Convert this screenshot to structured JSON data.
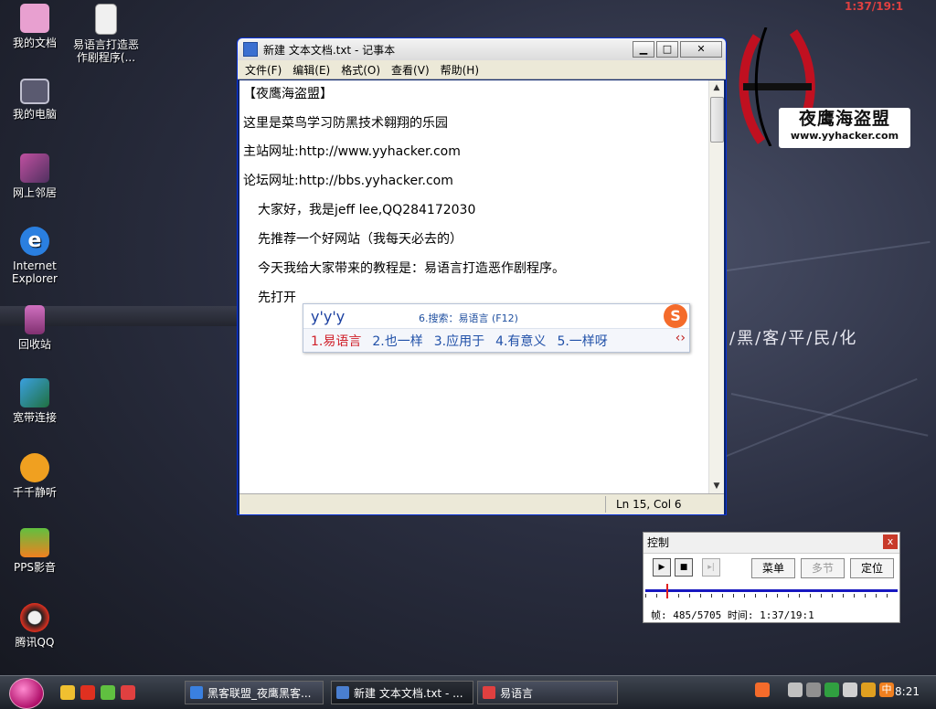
{
  "wallpaper": {
    "brand_cn": "夜鹰海盗盟",
    "brand_url": "www.yyhacker.com",
    "slogan": "/黑/客/平/民/化",
    "clock_overlay": "1:37/19:1"
  },
  "desktop_icons": [
    {
      "label": "我的文档",
      "icon": "my-documents-icon",
      "color": "#e8a0d0"
    },
    {
      "label": "易语言打造恶作剧程序(...",
      "icon": "text-document-icon",
      "color": "#f0f0f0"
    },
    {
      "label": "我的电脑",
      "icon": "my-computer-icon",
      "color": "#5a5a70"
    },
    {
      "label": "网上邻居",
      "icon": "network-places-icon",
      "color": "#c050a0"
    },
    {
      "label": "Internet Explorer",
      "icon": "internet-explorer-icon",
      "color": "#2a7fe0"
    },
    {
      "label": "回收站",
      "icon": "recycle-bin-icon",
      "color": "#c060b0"
    },
    {
      "label": "宽带连接",
      "icon": "broadband-connection-icon",
      "color": "#3aa0e0"
    },
    {
      "label": "千千静听",
      "icon": "ttplayer-icon",
      "color": "#f0a020"
    },
    {
      "label": "PPS影音",
      "icon": "pps-player-icon",
      "color": "#f08020"
    },
    {
      "label": "腾讯QQ",
      "icon": "tencent-qq-icon",
      "color": "#e03020"
    }
  ],
  "notepad": {
    "title": "新建 文本文档.txt - 记事本",
    "menu": [
      "文件(F)",
      "编辑(E)",
      "格式(O)",
      "查看(V)",
      "帮助(H)"
    ],
    "lines": [
      "【夜鹰海盗盟】",
      "这里是菜鸟学习防黑技术翱翔的乐园",
      "主站网址:http://www.yyhacker.com",
      "论坛网址:http://bbs.yyhacker.com",
      "大家好，我是jeff lee,QQ284172030",
      "先推荐一个好网站（我每天必去的）",
      "今天我给大家带来的教程是：易语言打造恶作剧程序。",
      "先打开"
    ],
    "status_position": "Ln 15, Col 6"
  },
  "ime": {
    "composition": "y'y'y",
    "search_hint": "6.搜索：易语言 (F12)",
    "logo": "S",
    "candidates": [
      "1.易语言",
      "2.也一样",
      "3.应用于",
      "4.有意义",
      "5.一样呀"
    ]
  },
  "control_panel": {
    "title": "控制",
    "close": "x",
    "buttons": [
      "菜单",
      "多节",
      "定位"
    ],
    "frame_label": "帧:",
    "frame_value": "485/5705",
    "time_label": "时间:",
    "time_value": "1:37/19:1",
    "progress_fraction": 0.085
  },
  "taskbar": {
    "tasks": [
      {
        "label": "黑客联盟_夜鹰黑客...",
        "icon": "ie-page-icon",
        "color": "#3a80e0"
      },
      {
        "label": "新建 文本文档.txt - ...",
        "icon": "notepad-icon",
        "color": "#4a7fd0"
      },
      {
        "label": "易语言",
        "icon": "eyuyan-icon",
        "color": "#e04040"
      }
    ],
    "clock": "8:21",
    "ime_indicator": "中"
  }
}
